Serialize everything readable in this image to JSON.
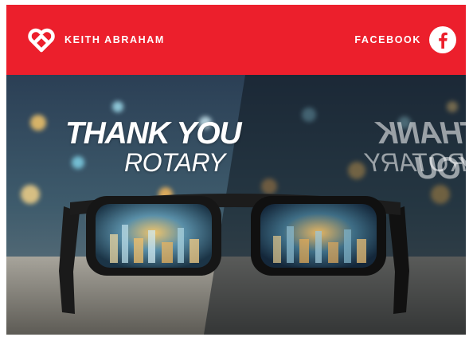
{
  "header": {
    "brand_name": "KEITH ABRAHAM",
    "logo_icon": "heart-knot-logo",
    "social_label": "FACEBOOK",
    "social_icon": "facebook-icon"
  },
  "hero": {
    "headline": "THANK YOU",
    "subheadline": "ROTARY",
    "image": "eyeglasses-on-table-city-lights"
  },
  "colors": {
    "header_bg": "#ec1f2c",
    "header_text": "#ffffff"
  }
}
